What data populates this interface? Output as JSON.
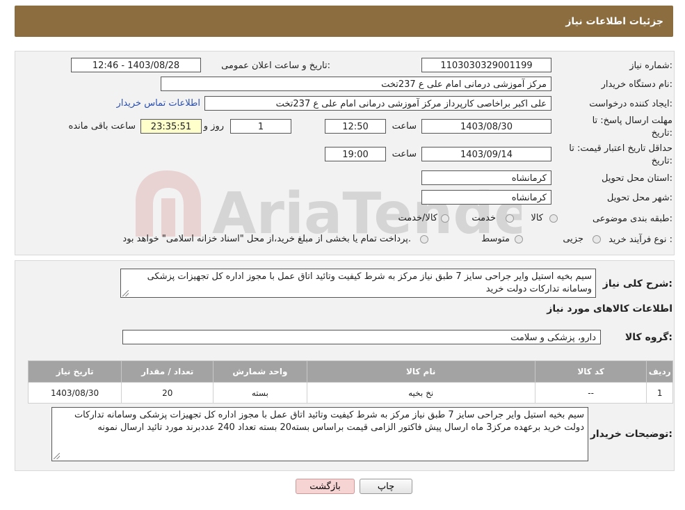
{
  "header": {
    "title": "جزئیات اطلاعات نیاز"
  },
  "form": {
    "need_number_label": "شماره نیاز:",
    "need_number": "1103030329001199",
    "announce_label": "تاریخ و ساعت اعلان عمومی:",
    "announce_value": "1403/08/28 - 12:46",
    "buyer_org_label": "نام دستگاه خریدار:",
    "buyer_org": "مرکز آموزشی درمانی امام علی ع 237تخت",
    "requester_label": "ایجاد کننده درخواست:",
    "requester": "علی اکبر براخاصی کارپرداز  مرکز آموزشی درمانی امام علی ع 237تخت",
    "contact_link": "اطلاعات تماس خریدار",
    "deadline_label_1": "مهلت ارسال پاسخ: تا",
    "deadline_label_2": "تاریخ:",
    "deadline_date": "1403/08/30",
    "time_label": "ساعت",
    "deadline_time": "12:50",
    "days_value": "1",
    "days_label": "روز و",
    "remaining_value": "23:35:51",
    "remaining_label": "ساعت باقی مانده",
    "validity_label_1": "حداقل تاریخ اعتبار قیمت: تا",
    "validity_label_2": "تاریخ:",
    "validity_date": "1403/09/14",
    "validity_time": "19:00",
    "province_label": "استان محل تحویل:",
    "province": "کرمانشاه",
    "city_label": "شهر محل تحویل:",
    "city": "کرمانشاه",
    "category_label": "طبقه بندی موضوعی:",
    "category_options": [
      "کالا",
      "خدمت",
      "کالا/خدمت"
    ],
    "purchase_type_label": "نوع فرآیند خرید :",
    "purchase_options": [
      "جزیی",
      "متوسط"
    ],
    "purchase_note": "پرداخت تمام یا بخشی از مبلغ خرید،از محل \"اسناد خزانه اسلامی\" خواهد بود."
  },
  "details": {
    "summary_label": "شرح کلی نیاز:",
    "summary": "سیم بخیه استیل وایر جراحی سایز 7 طبق نیاز مرکز به شرط کیفیت وتائید اتاق عمل با مجوز اداره کل تجهیزات پزشکی وسامانه تدارکات دولت خرید",
    "goods_info_title": "اطلاعات کالاهای مورد نیاز",
    "goods_group_label": "گروه کالا:",
    "goods_group": "دارو، پزشکی و سلامت",
    "table": {
      "headers": [
        "ردیف",
        "کد کالا",
        "نام کالا",
        "واحد شمارش",
        "تعداد / مقدار",
        "تاریخ نیاز"
      ],
      "rows": [
        [
          "1",
          "--",
          "نخ بخیه",
          "بسته",
          "20",
          "1403/08/30"
        ]
      ]
    },
    "buyer_notes_label": "توضیحات خریدار:",
    "buyer_notes": "سیم بخیه استیل وایر جراحی سایز 7 طبق نیاز مرکز به شرط کیفیت وتائید اتاق عمل با مجوز اداره کل تجهیزات پزشکی وسامانه تدارکات دولت خرید برعهده مرکز3 ماه ارسال پیش فاکتور الزامی قیمت براساس بسته20 بسته تعداد 240 عددبرند مورد تائید ارسال نمونه"
  },
  "buttons": {
    "print": "چاپ",
    "back": "بازگشت"
  },
  "watermark": {
    "text": "AriaTender.neT"
  },
  "colors": {
    "header_bg": "#8b6d40",
    "link": "#2a4fb0",
    "table_header_bg": "#a3a3a3",
    "back_button_bg": "#f7d4d4",
    "remaining_bg": "#ffffcc"
  }
}
